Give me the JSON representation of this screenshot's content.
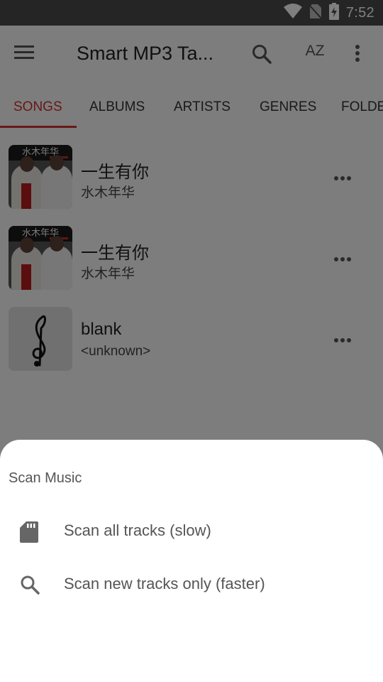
{
  "status_bar": {
    "time": "7:52"
  },
  "app_bar": {
    "title": "Smart MP3 Ta...",
    "sort_label": "AZ",
    "icons": [
      "menu-icon",
      "search-icon",
      "sort-az-icon",
      "more-vert-icon"
    ]
  },
  "tabs": [
    {
      "label": "SONGS",
      "active": true
    },
    {
      "label": "ALBUMS",
      "active": false
    },
    {
      "label": "ARTISTS",
      "active": false
    },
    {
      "label": "GENRES",
      "active": false
    },
    {
      "label": "FOLDE",
      "active": false
    }
  ],
  "songs": [
    {
      "title": "一生有你",
      "artist": "水木年华",
      "art_text": "水木年华"
    },
    {
      "title": "一生有你",
      "artist": "水木年华",
      "art_text": "水木年华"
    },
    {
      "title": "blank",
      "artist": "<unknown>"
    }
  ],
  "sheet": {
    "title": "Scan Music",
    "items": [
      {
        "label": "Scan all tracks (slow)",
        "icon": "sd-card-icon"
      },
      {
        "label": "Scan new tracks only (faster)",
        "icon": "search-icon"
      }
    ]
  },
  "colors": {
    "accent": "#d32f2f",
    "status_bar": "#4a4a4a",
    "scrim": "rgba(0,0,0,0.5)"
  }
}
